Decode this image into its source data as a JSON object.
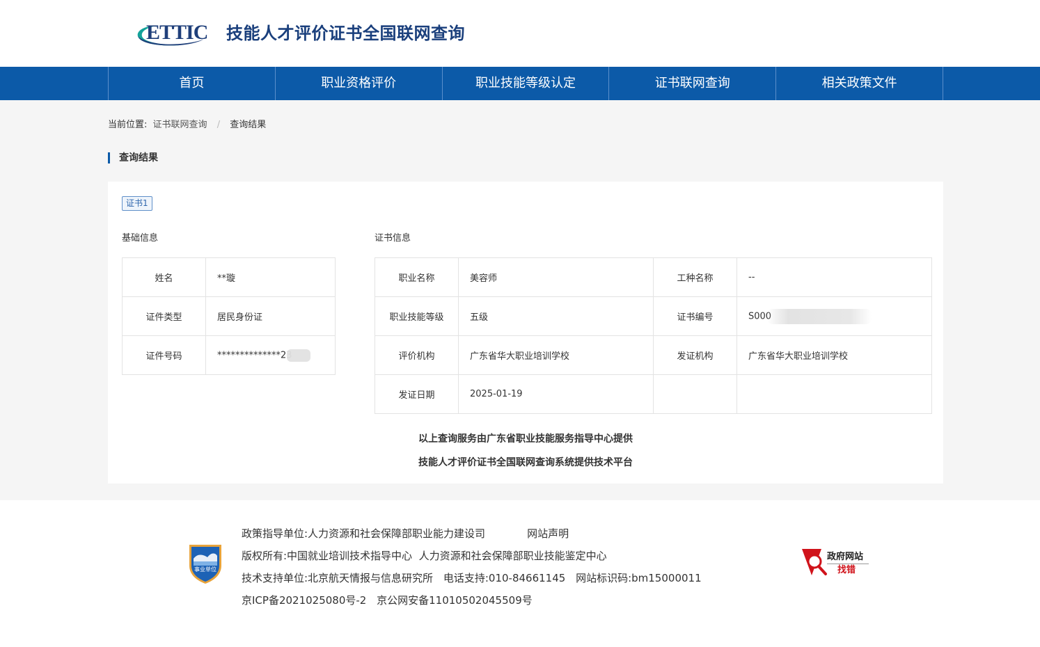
{
  "header": {
    "logo_text": "ETTIC",
    "site_title": "技能人才评价证书全国联网查询"
  },
  "nav": {
    "items": [
      {
        "label": "首页"
      },
      {
        "label": "职业资格评价"
      },
      {
        "label": "职业技能等级认定"
      },
      {
        "label": "证书联网查询"
      },
      {
        "label": "相关政策文件"
      }
    ]
  },
  "breadcrumb": {
    "prefix": "当前位置:",
    "items": [
      "证书联网查询",
      "查询结果"
    ],
    "separator": "/"
  },
  "section_title": "查询结果",
  "result": {
    "tab_label": "证书1",
    "basic": {
      "title": "基础信息",
      "rows": [
        {
          "label": "姓名",
          "value": "**璇"
        },
        {
          "label": "证件类型",
          "value": "居民身份证"
        },
        {
          "label": "证件号码",
          "value": "**************23"
        }
      ]
    },
    "certificate": {
      "title": "证书信息",
      "rows": [
        {
          "label1": "职业名称",
          "value1": "美容师",
          "label2": "工种名称",
          "value2": "--"
        },
        {
          "label1": "职业技能等级",
          "value1": "五级",
          "label2": "证书编号",
          "value2": "S000"
        },
        {
          "label1": "评价机构",
          "value1": "广东省华大职业培训学校",
          "label2": "发证机构",
          "value2": "广东省华大职业培训学校"
        },
        {
          "label1": "发证日期",
          "value1": "2025-01-19",
          "label2": "",
          "value2": ""
        }
      ]
    },
    "provider_line1": "以上查询服务由广东省职业技能服务指导中心提供",
    "provider_line2": "技能人才评价证书全国联网查询系统提供技术平台"
  },
  "footer": {
    "badge_text": "事业单位",
    "policy_unit": "政策指导单位:人力资源和社会保障部职业能力建设司",
    "statement": "网站声明",
    "copyright": "版权所有:中国就业培训技术指导中心  人力资源和社会保障部职业技能鉴定中心",
    "tech_support": "技术支持单位:北京航天情报与信息研究所",
    "phone": "电话支持:010-84661145",
    "site_code": "网站标识码:bm15000011",
    "icp": "京ICP备2021025080号-2",
    "police": "京公网安备11010502045509号",
    "gov_error_line1": "政府网站",
    "gov_error_line2": "找错"
  },
  "colors": {
    "nav_bg": "#0c5aa8",
    "title_blue": "#1a3f7c",
    "logo_swoosh": "#14a39a",
    "accent_red": "#d0131b",
    "page_bg": "#f5f5f5"
  }
}
